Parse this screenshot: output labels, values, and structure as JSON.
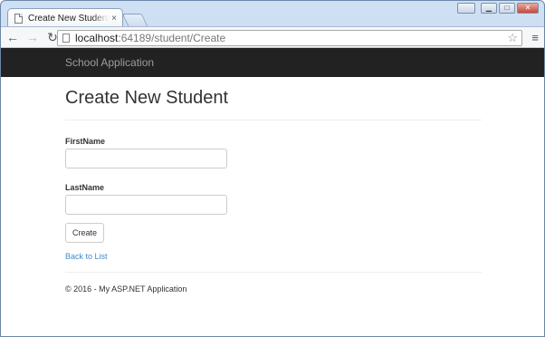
{
  "browser": {
    "tab_title": "Create New Student - MVC",
    "tab_close": "×",
    "url_host": "localhost",
    "url_rest": ":64189/student/Create",
    "icons": {
      "back": "←",
      "forward": "→",
      "reload": "↻",
      "star": "☆",
      "menu": "≡",
      "minimize": "▁",
      "maximize": "□",
      "close": "✕"
    }
  },
  "navbar": {
    "brand": "School Application"
  },
  "page": {
    "title": "Create New Student",
    "firstname_label": "FirstName",
    "firstname_value": "",
    "lastname_label": "LastName",
    "lastname_value": "",
    "create_button": "Create",
    "back_link": "Back to List",
    "footer": "© 2016 - My ASP.NET Application"
  },
  "colors": {
    "navbar_bg": "#222222",
    "brand_text": "#9d9d9d",
    "link": "#428bca"
  }
}
